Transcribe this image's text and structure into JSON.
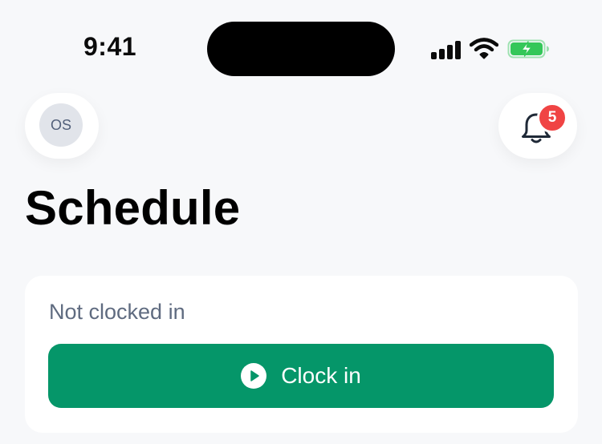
{
  "status_bar": {
    "time": "9:41",
    "signal_icon": "cellular-signal-icon",
    "wifi_icon": "wifi-icon",
    "battery_icon": "battery-charging-icon",
    "battery_color": "#34c759"
  },
  "header": {
    "avatar_initials": "OS",
    "notification_icon": "bell-icon",
    "notification_count": "5"
  },
  "page": {
    "title": "Schedule"
  },
  "clock_card": {
    "status": "Not clocked in",
    "button_label": "Clock in",
    "button_icon": "play-circle-icon",
    "button_color": "#059669"
  },
  "colors": {
    "background": "#f7f8fa",
    "badge": "#f04444",
    "muted_text": "#5f6b80"
  }
}
